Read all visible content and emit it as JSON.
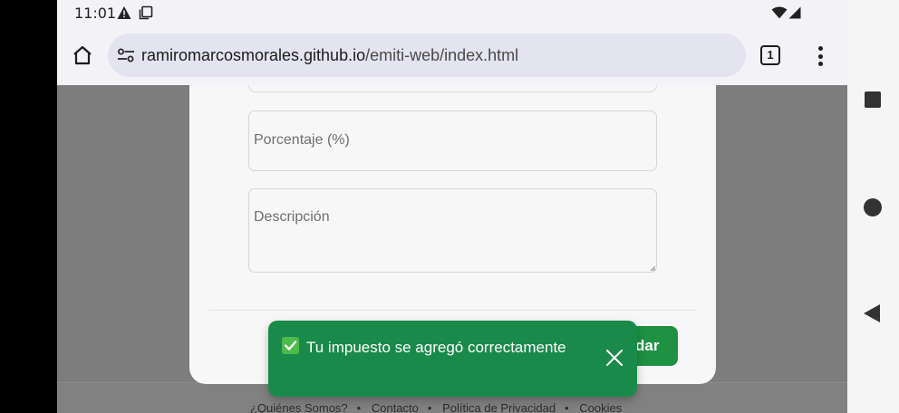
{
  "status_bar": {
    "time": "11:01",
    "icons": [
      "alert-triangle-icon",
      "copy-icon",
      "wifi-icon",
      "signal-icon"
    ]
  },
  "browser": {
    "url_domain": "ramiromarcosmorales.github.io",
    "url_path": "/emiti-web/index.html",
    "tab_count": "1",
    "icons": [
      "home-icon",
      "tune-icon",
      "tabs-icon",
      "more-vert-icon"
    ]
  },
  "form": {
    "porcentaje_placeholder": "Porcentaje (%)",
    "descripcion_placeholder": "Descripción",
    "save_label_visible": "dar"
  },
  "toast": {
    "message": "Tu impuesto se agregó correctamente",
    "icon": "check-mark-icon",
    "close_icon": "close-icon",
    "color": "#1a8a4a"
  },
  "footer": {
    "links": [
      "¿Quiénes Somos?",
      "Contacto",
      "Política de Privacidad",
      "Cookies"
    ]
  },
  "nav_bar": {
    "icons": [
      "recents-square-icon",
      "home-circle-icon",
      "back-triangle-icon"
    ]
  }
}
